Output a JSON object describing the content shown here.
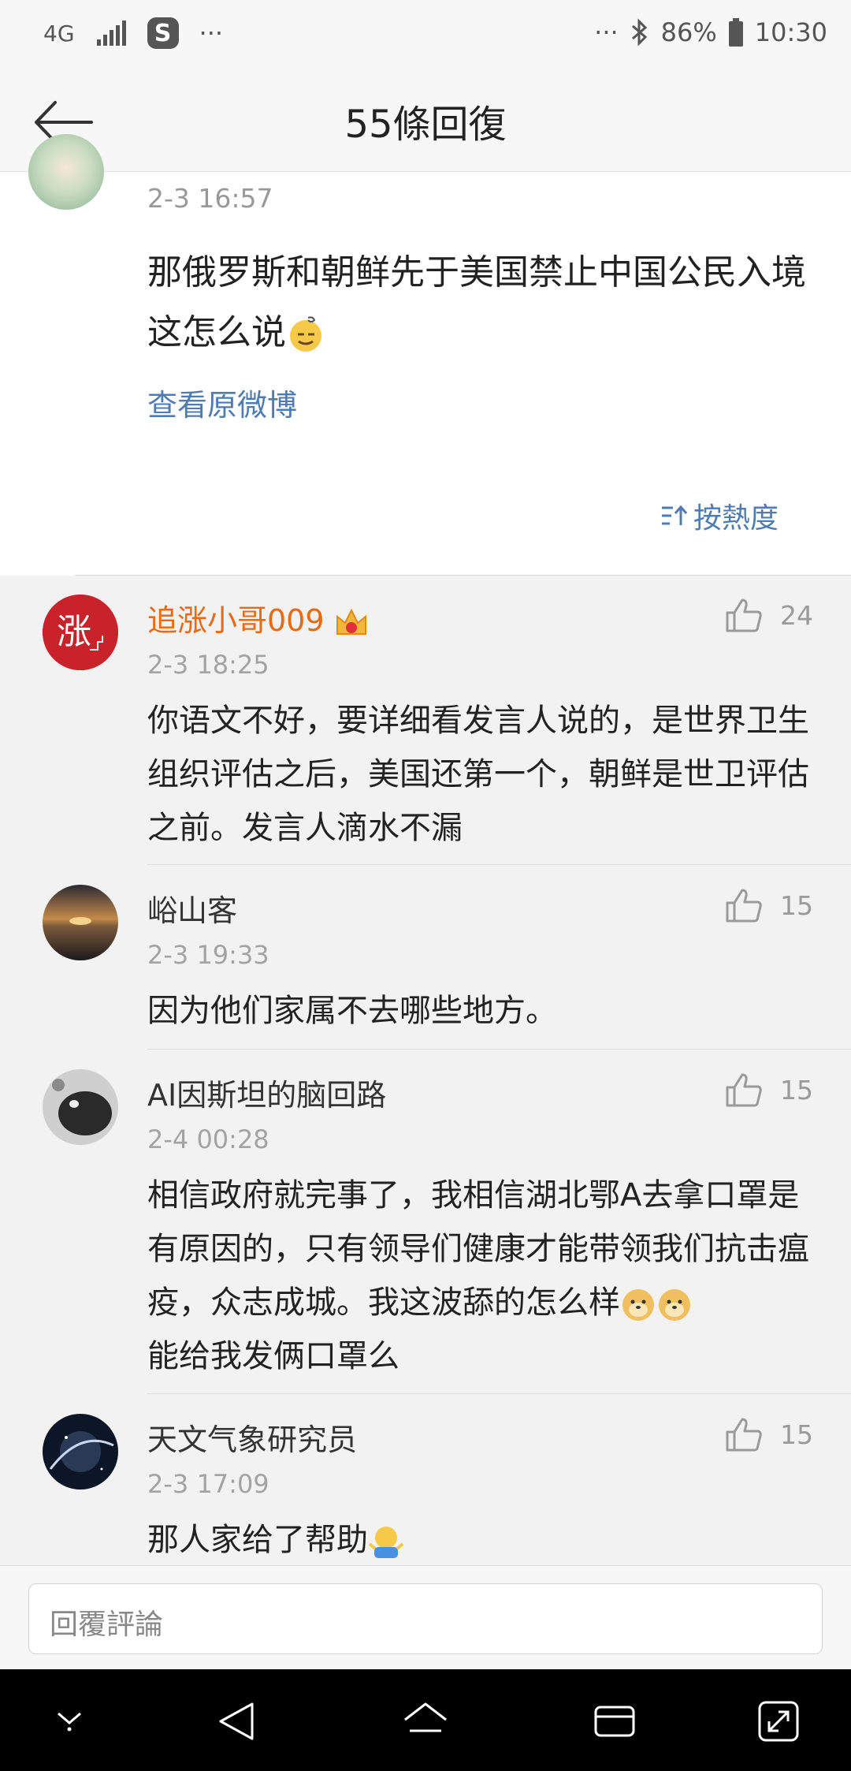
{
  "status_bar": {
    "network": "4G",
    "s_badge": "S",
    "dots_left": "···",
    "dots_right": "···",
    "battery": "86%",
    "time": "10:30"
  },
  "header": {
    "title": "55條回復"
  },
  "top_post": {
    "time": "2-3 16:57",
    "text": "那俄罗斯和朝鲜先于美国禁止中国公民入境这怎么说",
    "view_original": "查看原微博",
    "sort_label": "按熱度"
  },
  "comments": [
    {
      "name": "追涨小哥009",
      "time": "2-3 18:25",
      "likes": "24",
      "text": "你语文不好，要详细看发言人说的，是世界卫生组织评估之后，美国还第一个，朝鲜是世卫评估之前。发言人滴水不漏"
    },
    {
      "name": "峪山客",
      "time": "2-3 19:33",
      "likes": "15",
      "text": "因为他们家属不去哪些地方。"
    },
    {
      "name": "AI因斯坦的脑回路",
      "time": "2-4 00:28",
      "likes": "15",
      "text": "相信政府就完事了，我相信湖北鄂A去拿口罩是有原因的，只有领导们健康才能带领我们抗击瘟疫，众志成城。我这波舔的怎么样",
      "text2": "能给我发俩口罩么"
    },
    {
      "name": "天文气象研究员",
      "time": "2-3 17:09",
      "likes": "15",
      "text": "那人家给了帮助"
    }
  ],
  "reply": {
    "placeholder": "回覆評論"
  },
  "colors": {
    "link": "#4f7bb1",
    "vip_name": "#e96a10",
    "comment_bg": "#f2f2f2"
  },
  "icons": [
    "back-arrow-icon",
    "thumbs-up-icon",
    "crown-icon",
    "sort-icon",
    "bluetooth-icon",
    "battery-icon",
    "signal-icon"
  ]
}
